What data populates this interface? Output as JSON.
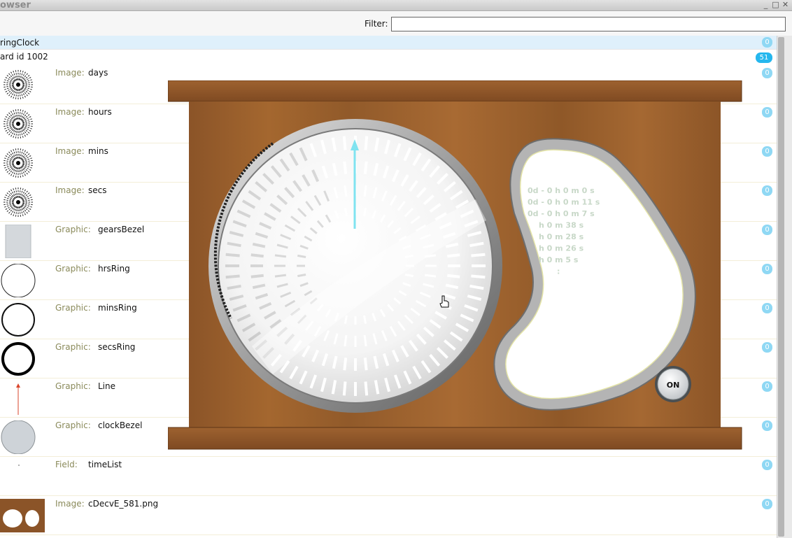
{
  "window": {
    "title": "owser",
    "btn_min": "_",
    "btn_max": "□",
    "btn_close": "✕"
  },
  "filter": {
    "label": "Filter:",
    "value": ""
  },
  "stack_row": {
    "label": "ringClock",
    "count": "0"
  },
  "card_row": {
    "label": "ard id 1002",
    "count": "51"
  },
  "controls": [
    {
      "type": "Image:",
      "name": "days",
      "count": "0",
      "thumb": "ring-dots"
    },
    {
      "type": "Image:",
      "name": "hours",
      "count": "0",
      "thumb": "ring-dots"
    },
    {
      "type": "Image:",
      "name": "mins",
      "count": "0",
      "thumb": "ring-dots"
    },
    {
      "type": "Image:",
      "name": "secs",
      "count": "0",
      "thumb": "ring-dots"
    },
    {
      "type": "Graphic:",
      "name": "gearsBezel",
      "count": "0",
      "thumb": "grey-rect"
    },
    {
      "type": "Graphic:",
      "name": "hrsRing",
      "count": "0",
      "thumb": "thin-circle"
    },
    {
      "type": "Graphic:",
      "name": "minsRing",
      "count": "0",
      "thumb": "mid-circle"
    },
    {
      "type": "Graphic:",
      "name": "secsRing",
      "count": "0",
      "thumb": "thick-circle"
    },
    {
      "type": "Graphic:",
      "name": "Line",
      "count": "0",
      "thumb": "red-line"
    },
    {
      "type": "Graphic:",
      "name": "clockBezel",
      "count": "0",
      "thumb": "grey-circle"
    },
    {
      "type": "Field:",
      "name": "timeList",
      "count": "0",
      "thumb": "dot"
    },
    {
      "type": "Image:",
      "name": "cDecvE_581.png",
      "count": "0",
      "thumb": "wood-image"
    }
  ],
  "clock": {
    "time_list": [
      "0d - 0 h 0 m 0 s",
      "0d - 0 h 0 m 11 s",
      "0d - 0 h 0 m 7 s",
      "h 0 m 38 s",
      "h 0 m 28 s",
      "h 0 m 26 s",
      "h 0 m 5 s",
      ":"
    ],
    "on_button": "ON"
  },
  "colors": {
    "wood": "#a0622f",
    "wood_dark": "#7f4a22",
    "badge": "#8fd8f4",
    "badge_dark": "#25b7ee",
    "stack_highlight": "#dff0fb"
  }
}
